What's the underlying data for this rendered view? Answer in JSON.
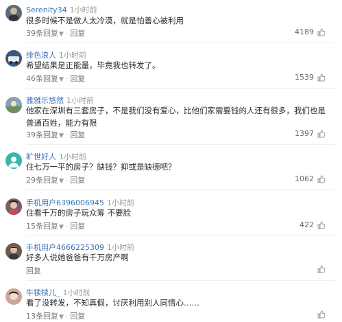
{
  "comments": [
    {
      "user": "Serenity34",
      "time": "1小时前",
      "text": "很多时候不是做人太冷漠，就是怕善心被利用",
      "replies": "39条回复",
      "likes": "4189",
      "avatar_color": "#5f6a75"
    },
    {
      "user": "绯色浪人",
      "time": "1小时前",
      "text": "希望结果是正能量，毕竟我也转发了。",
      "replies": "46条回复",
      "likes": "1539",
      "avatar_color": "#3a5a7a"
    },
    {
      "user": "雅雅乐悠然",
      "time": "1小时前",
      "text": "他家在深圳有三套房子，不是我们没有爱心，比他们家需要钱的人还有很多，我们也是普通百姓，能力有限",
      "replies": "39条回复",
      "likes": "1397",
      "avatar_color": "#8aa0b8"
    },
    {
      "user": "旷世好人",
      "time": "1小时前",
      "text": "住七万一平的房子？缺钱？抑或是缺德吧？",
      "replies": "29条回复",
      "likes": "1062",
      "avatar_color": "#3bb4a8"
    },
    {
      "user": "手机用户6396006945",
      "time": "1小时前",
      "text": "住看千万的房子玩众筹 不要脸",
      "replies": "15条回复",
      "likes": "422",
      "avatar_color": "#7a5f6a"
    },
    {
      "user": "手机用户4666225309",
      "time": "1小时前",
      "text": "好多人说她爸爸有千万房产啊",
      "replies": "",
      "likes": "",
      "avatar_color": "#6b5b52"
    },
    {
      "user": "牛犊犊儿_",
      "time": "1小时前",
      "text": "看了没转发，不知真假，讨厌利用别人同情心……",
      "replies": "13条回复",
      "likes": "",
      "avatar_color": "#c9a89a"
    }
  ],
  "labels": {
    "reply": "回复"
  },
  "colors": {
    "username": "#3a73b8",
    "time": "#9a9a9a"
  }
}
